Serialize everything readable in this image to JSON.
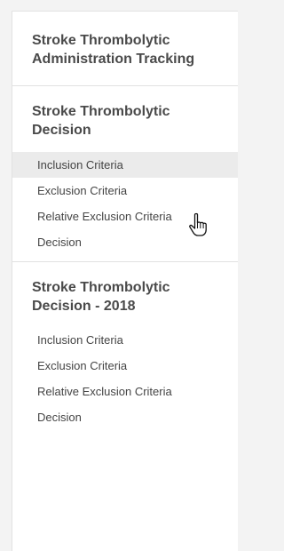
{
  "nav": {
    "sections": [
      {
        "title": "Stroke Thrombolytic Administration Tracking",
        "items": []
      },
      {
        "title": "Stroke Thrombolytic Decision",
        "items": [
          {
            "label": "Inclusion Criteria"
          },
          {
            "label": "Exclusion Criteria"
          },
          {
            "label": "Relative Exclusion Criteria"
          },
          {
            "label": "Decision"
          }
        ]
      },
      {
        "title": "Stroke Thrombolytic Decision - 2018",
        "items": [
          {
            "label": "Inclusion Criteria"
          },
          {
            "label": "Exclusion Criteria"
          },
          {
            "label": "Relative Exclusion Criteria"
          },
          {
            "label": "Decision"
          }
        ]
      }
    ]
  },
  "cursor": {
    "icon": "hand-pointer-icon"
  },
  "colors": {
    "background": "#f3f3f3",
    "hover": "#ebebeb",
    "text": "#444444"
  }
}
